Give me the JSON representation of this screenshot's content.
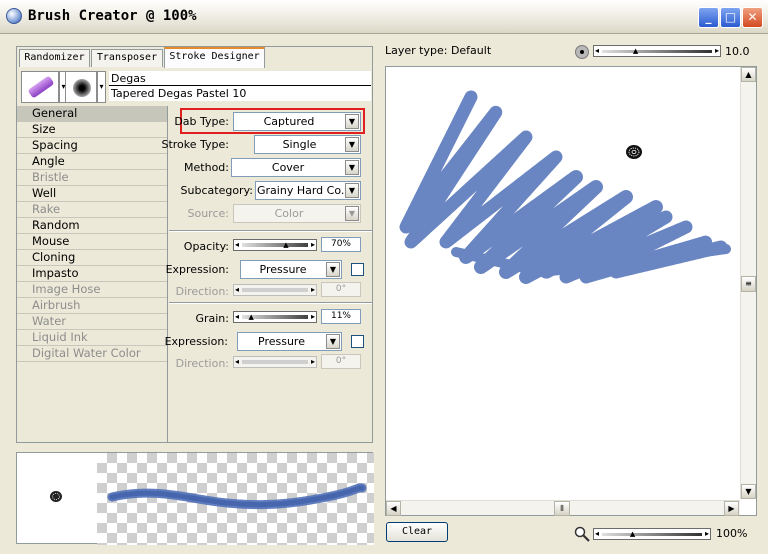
{
  "window": {
    "title": "Brush Creator @ 100%",
    "min_glyph": "_",
    "max_glyph": "□",
    "close_glyph": "✕"
  },
  "tabs": [
    {
      "label": "Randomizer"
    },
    {
      "label": "Transposer"
    },
    {
      "label": "Stroke Designer",
      "active": true
    }
  ],
  "brush": {
    "category": "Degas",
    "variant": "Tapered Degas Pastel 10"
  },
  "categories": [
    {
      "label": "General",
      "selected": true,
      "enabled": true
    },
    {
      "label": "Size",
      "enabled": true
    },
    {
      "label": "Spacing",
      "enabled": true
    },
    {
      "label": "Angle",
      "enabled": true
    },
    {
      "label": "Bristle",
      "enabled": false
    },
    {
      "label": "Well",
      "enabled": true
    },
    {
      "label": "Rake",
      "enabled": false
    },
    {
      "label": "Random",
      "enabled": true
    },
    {
      "label": "Mouse",
      "enabled": true
    },
    {
      "label": "Cloning",
      "enabled": true
    },
    {
      "label": "Impasto",
      "enabled": true
    },
    {
      "label": "Image Hose",
      "enabled": false
    },
    {
      "label": "Airbrush",
      "enabled": false
    },
    {
      "label": "Water",
      "enabled": false
    },
    {
      "label": "Liquid Ink",
      "enabled": false
    },
    {
      "label": "Digital Water Color",
      "enabled": false
    }
  ],
  "general": {
    "dab_type": {
      "label": "Dab Type:",
      "value": "Captured"
    },
    "stroke_type": {
      "label": "Stroke Type:",
      "value": "Single"
    },
    "method": {
      "label": "Method:",
      "value": "Cover"
    },
    "subcategory": {
      "label": "Subcategory:",
      "value": "Grainy Hard Co..."
    },
    "source": {
      "label": "Source:",
      "value": "Color"
    },
    "opacity": {
      "label": "Opacity:",
      "value": "70%",
      "level": 0.7
    },
    "opacity_expression": {
      "label": "Expression:",
      "value": "Pressure"
    },
    "opacity_direction": {
      "label": "Direction:",
      "value": "0°"
    },
    "grain": {
      "label": "Grain:",
      "value": "11%",
      "level": 0.11
    },
    "grain_expression": {
      "label": "Expression:",
      "value": "Pressure"
    },
    "grain_direction": {
      "label": "Direction:",
      "value": "0°"
    }
  },
  "canvas": {
    "layer_type": "Layer type: Default",
    "brush_size": "10.0",
    "brush_size_level": 0.3,
    "zoom": "100%",
    "zoom_level": 0.3,
    "clear_label": "Clear"
  },
  "colors": {
    "stroke": "#5070b8",
    "highlight": "#e0201f",
    "tab_accent": "#e68b2c"
  }
}
